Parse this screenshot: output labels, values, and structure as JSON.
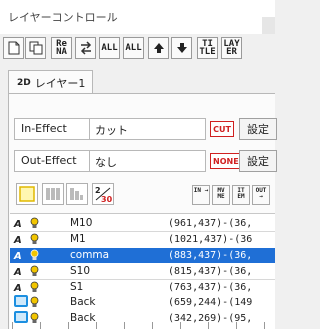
{
  "window": {
    "title": "レイヤーコントロール"
  },
  "toolbar": {
    "buttons": [
      {
        "icon": "new-document-icon",
        "label": ""
      },
      {
        "icon": "copy-icon",
        "label": ""
      },
      {
        "icon": "rename-icon",
        "label": "Re NA"
      },
      {
        "icon": "swap-icon",
        "label": ""
      },
      {
        "icon": "swap-all-icon",
        "label": "ALL"
      },
      {
        "icon": "swap-all-alt-icon",
        "label": "ALL"
      },
      {
        "icon": "arrow-up-icon",
        "label": ""
      },
      {
        "icon": "arrow-down-icon",
        "label": ""
      },
      {
        "icon": "title-icon",
        "label": "TI TLE"
      },
      {
        "icon": "layer-icon",
        "label": "LAY ER"
      }
    ]
  },
  "tabs": [
    {
      "badge": "2D",
      "label": "レイヤー1"
    }
  ],
  "effects": [
    {
      "label": "In-Effect",
      "value": "カット",
      "badge": "CUT",
      "button": "設定"
    },
    {
      "label": "Out-Effect",
      "value": "なし",
      "badge": "NONE",
      "button": "設定"
    }
  ],
  "icon_row": {
    "buttons": [
      {
        "icon": "color-box-yellow-icon"
      },
      {
        "icon": "bars-icon"
      },
      {
        "icon": "bars-sort-icon"
      },
      {
        "icon": "fraction-icon",
        "label": "2/30"
      }
    ],
    "small_buttons": [
      "IN →",
      "MV ME",
      "IT EM",
      "OUT →"
    ]
  },
  "layers": [
    {
      "cam": "A",
      "name": "M10",
      "coords": "(961,437)-(36,",
      "selected": false,
      "type": "normal"
    },
    {
      "cam": "A",
      "name": "M1",
      "coords": "(1021,437)-(36",
      "selected": false,
      "type": "normal"
    },
    {
      "cam": "A",
      "name": "comma",
      "coords": "(883,437)-(36,",
      "selected": true,
      "type": "normal"
    },
    {
      "cam": "A",
      "name": "S10",
      "coords": "(815,437)-(36,",
      "selected": false,
      "type": "normal"
    },
    {
      "cam": "A",
      "name": "S1",
      "coords": "(763,437)-(36,",
      "selected": false,
      "type": "normal"
    },
    {
      "cam": "",
      "name": "Back",
      "coords": "(659,244)-(149",
      "selected": false,
      "type": "box"
    },
    {
      "cam": "",
      "name": "Back",
      "coords": "(342,269)-(95,",
      "selected": false,
      "type": "box"
    }
  ],
  "colors": {
    "selection": "#1f6fd6",
    "badge_red": "#d02020",
    "box_blue": "#1c8fe0",
    "bulb_yellow": "#f2c500"
  }
}
